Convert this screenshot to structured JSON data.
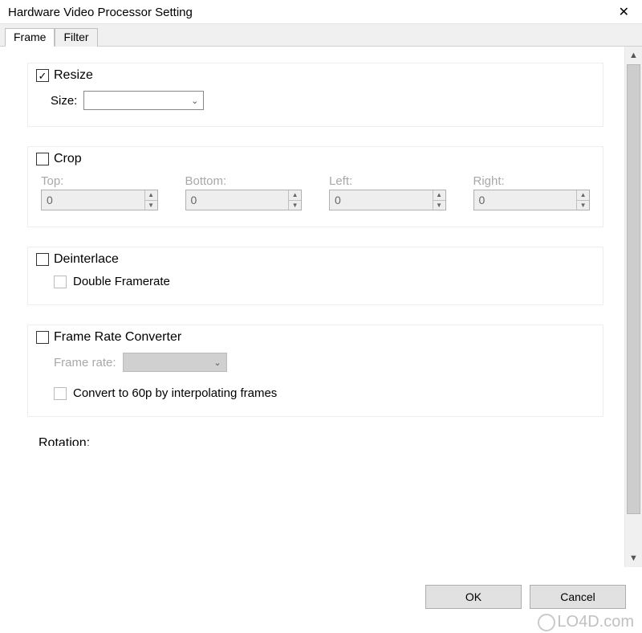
{
  "window": {
    "title": "Hardware Video Processor Setting"
  },
  "tabs": {
    "frame": "Frame",
    "filter": "Filter"
  },
  "resize": {
    "title": "Resize",
    "checked": true,
    "size_label": "Size:",
    "size_value": ""
  },
  "crop": {
    "title": "Crop",
    "checked": false,
    "top_label": "Top:",
    "bottom_label": "Bottom:",
    "left_label": "Left:",
    "right_label": "Right:",
    "top": "0",
    "bottom": "0",
    "left": "0",
    "right": "0"
  },
  "deinterlace": {
    "title": "Deinterlace",
    "checked": false,
    "double_label": "Double Framerate",
    "double_checked": false
  },
  "frc": {
    "title": "Frame Rate Converter",
    "checked": false,
    "rate_label": "Frame rate:",
    "rate_value": "",
    "convert_label": "Convert to 60p by interpolating frames",
    "convert_checked": false
  },
  "rotation": {
    "title_partial": "Rotation:"
  },
  "buttons": {
    "ok": "OK",
    "cancel": "Cancel"
  },
  "watermark": "LO4D.com"
}
